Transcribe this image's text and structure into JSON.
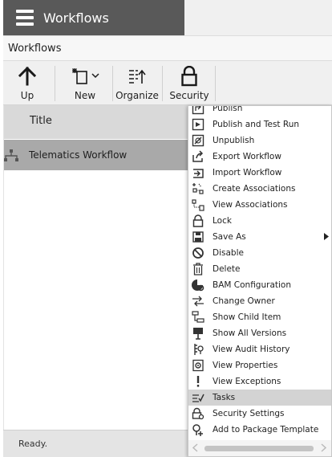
{
  "app": {
    "title": "Workflows"
  },
  "breadcrumb": {
    "text": "Workflows"
  },
  "toolbar": {
    "up_label": "Up",
    "new_label": "New",
    "organize_label": "Organize",
    "security_label": "Security"
  },
  "list": {
    "header_title": "Title",
    "rows": [
      {
        "label": "Telematics Workflow"
      }
    ]
  },
  "status": {
    "text": "Ready."
  },
  "context_menu": {
    "items": [
      {
        "label": "Publish",
        "icon": "publish-icon"
      },
      {
        "label": "Publish and Test Run",
        "icon": "publish-test-run-icon"
      },
      {
        "label": "Unpublish",
        "icon": "unpublish-icon"
      },
      {
        "label": "Export Workflow",
        "icon": "export-icon"
      },
      {
        "label": "Import Workflow",
        "icon": "import-icon"
      },
      {
        "label": "Create Associations",
        "icon": "create-associations-icon"
      },
      {
        "label": "View Associations",
        "icon": "view-associations-icon"
      },
      {
        "label": "Lock",
        "icon": "lock-icon"
      },
      {
        "label": "Save As",
        "icon": "save-icon",
        "has_submenu": true
      },
      {
        "label": "Disable",
        "icon": "disable-icon"
      },
      {
        "label": "Delete",
        "icon": "trash-icon"
      },
      {
        "label": "BAM Configuration",
        "icon": "bam-config-icon"
      },
      {
        "label": "Change Owner",
        "icon": "change-owner-icon"
      },
      {
        "label": "Show Child Item",
        "icon": "child-item-icon"
      },
      {
        "label": "Show All Versions",
        "icon": "versions-icon"
      },
      {
        "label": "View Audit History",
        "icon": "audit-history-icon"
      },
      {
        "label": "View Properties",
        "icon": "properties-icon"
      },
      {
        "label": "View Exceptions",
        "icon": "exclamation-icon"
      },
      {
        "label": "Tasks",
        "icon": "tasks-icon",
        "active": true
      },
      {
        "label": "Security Settings",
        "icon": "security-settings-icon"
      },
      {
        "label": "Add to Package Template",
        "icon": "add-package-icon"
      }
    ]
  }
}
